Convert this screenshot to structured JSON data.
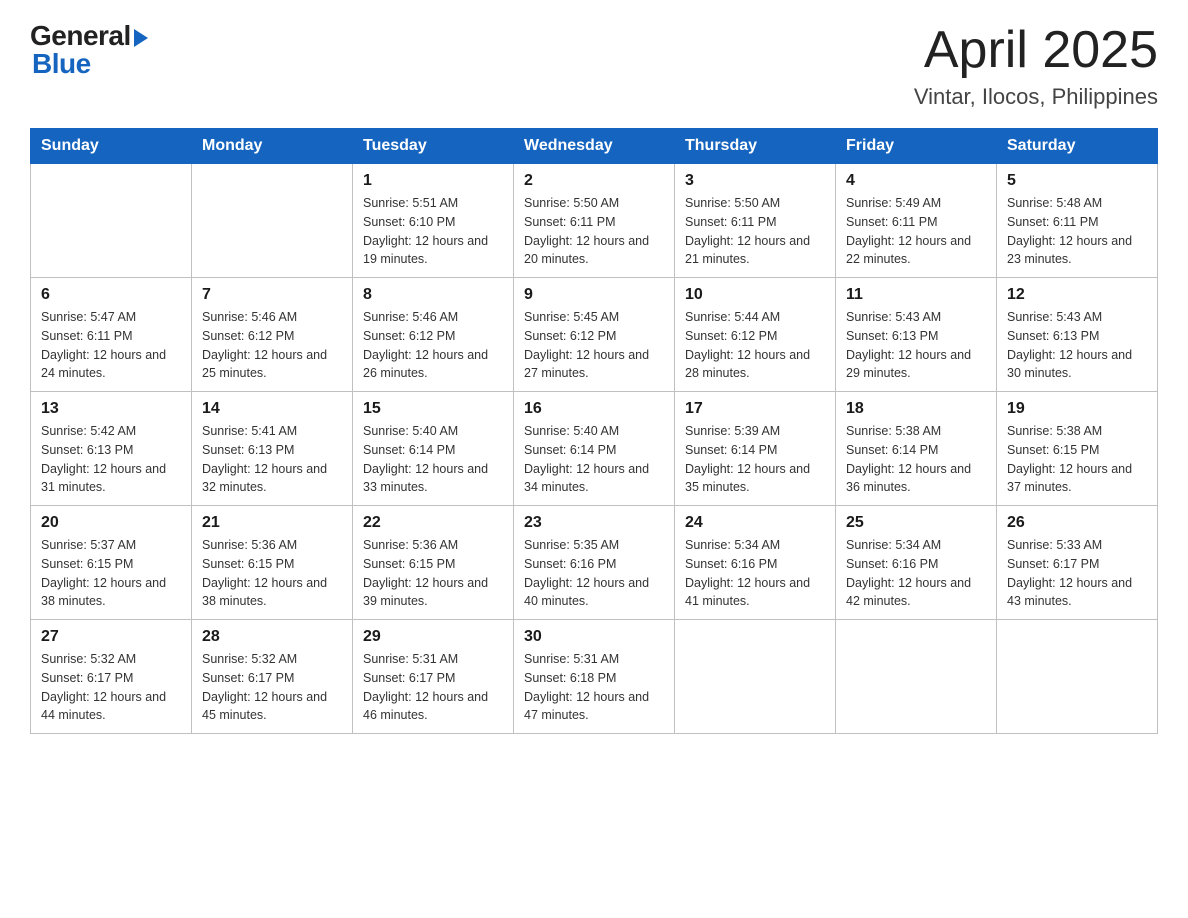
{
  "header": {
    "logo_general": "General",
    "logo_blue": "Blue",
    "month_title": "April 2025",
    "location": "Vintar, Ilocos, Philippines"
  },
  "days_of_week": [
    "Sunday",
    "Monday",
    "Tuesday",
    "Wednesday",
    "Thursday",
    "Friday",
    "Saturday"
  ],
  "weeks": [
    [
      {
        "day": "",
        "info": ""
      },
      {
        "day": "",
        "info": ""
      },
      {
        "day": "1",
        "info": "Sunrise: 5:51 AM\nSunset: 6:10 PM\nDaylight: 12 hours\nand 19 minutes."
      },
      {
        "day": "2",
        "info": "Sunrise: 5:50 AM\nSunset: 6:11 PM\nDaylight: 12 hours\nand 20 minutes."
      },
      {
        "day": "3",
        "info": "Sunrise: 5:50 AM\nSunset: 6:11 PM\nDaylight: 12 hours\nand 21 minutes."
      },
      {
        "day": "4",
        "info": "Sunrise: 5:49 AM\nSunset: 6:11 PM\nDaylight: 12 hours\nand 22 minutes."
      },
      {
        "day": "5",
        "info": "Sunrise: 5:48 AM\nSunset: 6:11 PM\nDaylight: 12 hours\nand 23 minutes."
      }
    ],
    [
      {
        "day": "6",
        "info": "Sunrise: 5:47 AM\nSunset: 6:11 PM\nDaylight: 12 hours\nand 24 minutes."
      },
      {
        "day": "7",
        "info": "Sunrise: 5:46 AM\nSunset: 6:12 PM\nDaylight: 12 hours\nand 25 minutes."
      },
      {
        "day": "8",
        "info": "Sunrise: 5:46 AM\nSunset: 6:12 PM\nDaylight: 12 hours\nand 26 minutes."
      },
      {
        "day": "9",
        "info": "Sunrise: 5:45 AM\nSunset: 6:12 PM\nDaylight: 12 hours\nand 27 minutes."
      },
      {
        "day": "10",
        "info": "Sunrise: 5:44 AM\nSunset: 6:12 PM\nDaylight: 12 hours\nand 28 minutes."
      },
      {
        "day": "11",
        "info": "Sunrise: 5:43 AM\nSunset: 6:13 PM\nDaylight: 12 hours\nand 29 minutes."
      },
      {
        "day": "12",
        "info": "Sunrise: 5:43 AM\nSunset: 6:13 PM\nDaylight: 12 hours\nand 30 minutes."
      }
    ],
    [
      {
        "day": "13",
        "info": "Sunrise: 5:42 AM\nSunset: 6:13 PM\nDaylight: 12 hours\nand 31 minutes."
      },
      {
        "day": "14",
        "info": "Sunrise: 5:41 AM\nSunset: 6:13 PM\nDaylight: 12 hours\nand 32 minutes."
      },
      {
        "day": "15",
        "info": "Sunrise: 5:40 AM\nSunset: 6:14 PM\nDaylight: 12 hours\nand 33 minutes."
      },
      {
        "day": "16",
        "info": "Sunrise: 5:40 AM\nSunset: 6:14 PM\nDaylight: 12 hours\nand 34 minutes."
      },
      {
        "day": "17",
        "info": "Sunrise: 5:39 AM\nSunset: 6:14 PM\nDaylight: 12 hours\nand 35 minutes."
      },
      {
        "day": "18",
        "info": "Sunrise: 5:38 AM\nSunset: 6:14 PM\nDaylight: 12 hours\nand 36 minutes."
      },
      {
        "day": "19",
        "info": "Sunrise: 5:38 AM\nSunset: 6:15 PM\nDaylight: 12 hours\nand 37 minutes."
      }
    ],
    [
      {
        "day": "20",
        "info": "Sunrise: 5:37 AM\nSunset: 6:15 PM\nDaylight: 12 hours\nand 38 minutes."
      },
      {
        "day": "21",
        "info": "Sunrise: 5:36 AM\nSunset: 6:15 PM\nDaylight: 12 hours\nand 38 minutes."
      },
      {
        "day": "22",
        "info": "Sunrise: 5:36 AM\nSunset: 6:15 PM\nDaylight: 12 hours\nand 39 minutes."
      },
      {
        "day": "23",
        "info": "Sunrise: 5:35 AM\nSunset: 6:16 PM\nDaylight: 12 hours\nand 40 minutes."
      },
      {
        "day": "24",
        "info": "Sunrise: 5:34 AM\nSunset: 6:16 PM\nDaylight: 12 hours\nand 41 minutes."
      },
      {
        "day": "25",
        "info": "Sunrise: 5:34 AM\nSunset: 6:16 PM\nDaylight: 12 hours\nand 42 minutes."
      },
      {
        "day": "26",
        "info": "Sunrise: 5:33 AM\nSunset: 6:17 PM\nDaylight: 12 hours\nand 43 minutes."
      }
    ],
    [
      {
        "day": "27",
        "info": "Sunrise: 5:32 AM\nSunset: 6:17 PM\nDaylight: 12 hours\nand 44 minutes."
      },
      {
        "day": "28",
        "info": "Sunrise: 5:32 AM\nSunset: 6:17 PM\nDaylight: 12 hours\nand 45 minutes."
      },
      {
        "day": "29",
        "info": "Sunrise: 5:31 AM\nSunset: 6:17 PM\nDaylight: 12 hours\nand 46 minutes."
      },
      {
        "day": "30",
        "info": "Sunrise: 5:31 AM\nSunset: 6:18 PM\nDaylight: 12 hours\nand 47 minutes."
      },
      {
        "day": "",
        "info": ""
      },
      {
        "day": "",
        "info": ""
      },
      {
        "day": "",
        "info": ""
      }
    ]
  ]
}
